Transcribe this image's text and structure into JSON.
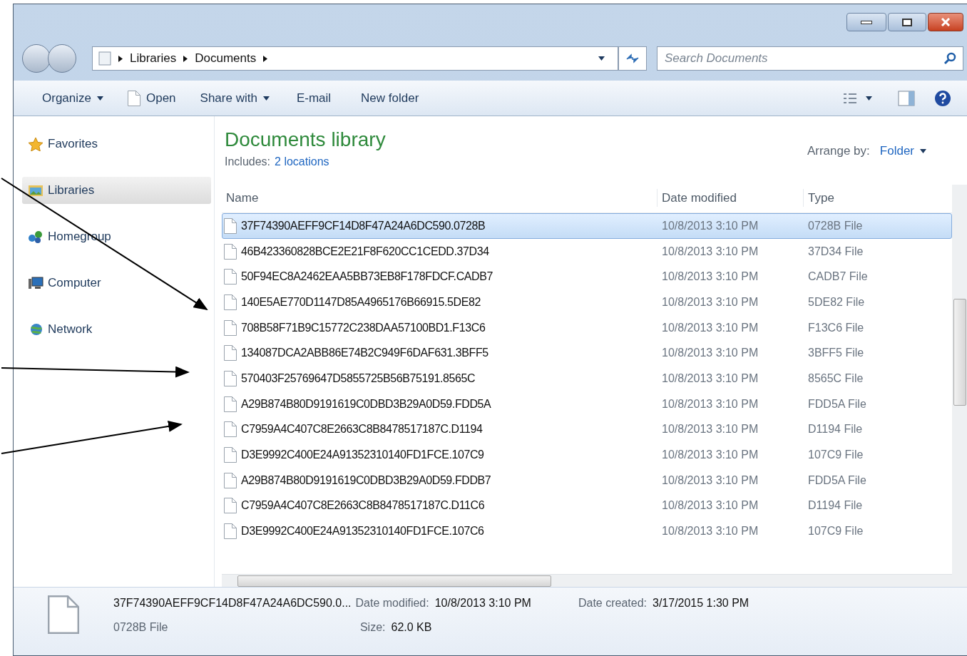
{
  "address": {
    "breadcrumbs": [
      "Libraries",
      "Documents"
    ],
    "search_placeholder": "Search Documents"
  },
  "toolbar": [
    {
      "label": "Organize",
      "kind": "menu"
    },
    {
      "label": "Open",
      "kind": "file"
    },
    {
      "label": "Share with",
      "kind": "menu"
    },
    {
      "label": "E-mail",
      "kind": "plain"
    },
    {
      "label": "New folder",
      "kind": "plain"
    }
  ],
  "sidebar": [
    {
      "label": "Favorites",
      "kind": "star",
      "selected": false
    },
    {
      "label": "Libraries",
      "kind": "library",
      "selected": true
    },
    {
      "label": "Homegroup",
      "kind": "homegroup",
      "selected": false
    },
    {
      "label": "Computer",
      "kind": "computer",
      "selected": false
    },
    {
      "label": "Network",
      "kind": "network",
      "selected": false
    }
  ],
  "library": {
    "title": "Documents library",
    "includes_label": "Includes:",
    "includes_link": "2 locations",
    "arrange_label": "Arrange by:",
    "arrange_value": "Folder"
  },
  "table": {
    "columns": [
      "Name",
      "Date modified",
      "Type"
    ],
    "rows": [
      {
        "name": "37F74390AEFF9CF14D8F47A24A6DC590.0728B",
        "date": "10/8/2013 3:10 PM",
        "type": "0728B File",
        "selected": true
      },
      {
        "name": "46B423360828BCE2E21F8F620CC1CEDD.37D34",
        "date": "10/8/2013 3:10 PM",
        "type": "37D34 File",
        "selected": false
      },
      {
        "name": "50F94EC8A2462EAA5BB73EB8F178FDCF.CADB7",
        "date": "10/8/2013 3:10 PM",
        "type": "CADB7 File",
        "selected": false
      },
      {
        "name": "140E5AE770D1147D85A4965176B66915.5DE82",
        "date": "10/8/2013 3:10 PM",
        "type": "5DE82 File",
        "selected": false
      },
      {
        "name": "708B58F71B9C15772C238DAA57100BD1.F13C6",
        "date": "10/8/2013 3:10 PM",
        "type": "F13C6 File",
        "selected": false
      },
      {
        "name": "134087DCA2ABB86E74B2C949F6DAF631.3BFF5",
        "date": "10/8/2013 3:10 PM",
        "type": "3BFF5 File",
        "selected": false
      },
      {
        "name": "570403F25769647D5855725B56B75191.8565C",
        "date": "10/8/2013 3:10 PM",
        "type": "8565C File",
        "selected": false
      },
      {
        "name": "A29B874B80D9191619C0DBD3B29A0D59.FDD5A",
        "date": "10/8/2013 3:10 PM",
        "type": "FDD5A File",
        "selected": false
      },
      {
        "name": "C7959A4C407C8E2663C8B8478517187C.D1194",
        "date": "10/8/2013 3:10 PM",
        "type": "D1194 File",
        "selected": false
      },
      {
        "name": "D3E9992C400E24A91352310140FD1FCE.107C9",
        "date": "10/8/2013 3:10 PM",
        "type": "107C9 File",
        "selected": false
      },
      {
        "name": "A29B874B80D9191619C0DBD3B29A0D59.FDDB7",
        "date": "10/8/2013 3:10 PM",
        "type": "FDD5A File",
        "selected": false
      },
      {
        "name": "C7959A4C407C8E2663C8B8478517187C.D11C6",
        "date": "10/8/2013 3:10 PM",
        "type": "D1194 File",
        "selected": false
      },
      {
        "name": "D3E9992C400E24A91352310140FD1FCE.107C6",
        "date": "10/8/2013 3:10 PM",
        "type": "107C9 File",
        "selected": false
      }
    ]
  },
  "details": {
    "name": "37F74390AEFF9CF14D8F47A24A6DC590.0...",
    "type": "0728B File",
    "modified_label": "Date modified:",
    "modified_value": "10/8/2013 3:10 PM",
    "size_label": "Size:",
    "size_value": "62.0 KB",
    "created_label": "Date created:",
    "created_value": "3/17/2015 1:30 PM"
  }
}
